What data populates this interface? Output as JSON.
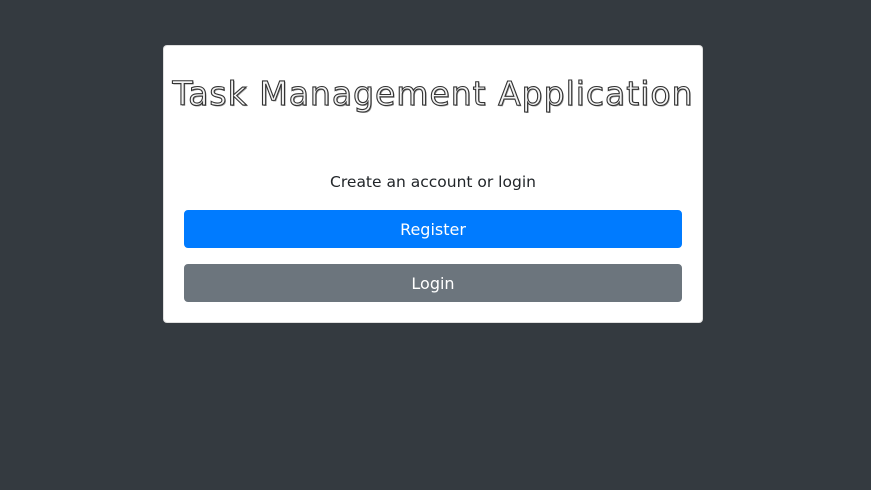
{
  "app": {
    "title": "Task Management Application",
    "subtitle": "Create an account or login"
  },
  "actions": {
    "register_label": "Register",
    "login_label": "Login"
  },
  "colors": {
    "page_background": "#343a40",
    "card_background": "#ffffff",
    "primary": "#007bff",
    "secondary": "#6c757d"
  }
}
